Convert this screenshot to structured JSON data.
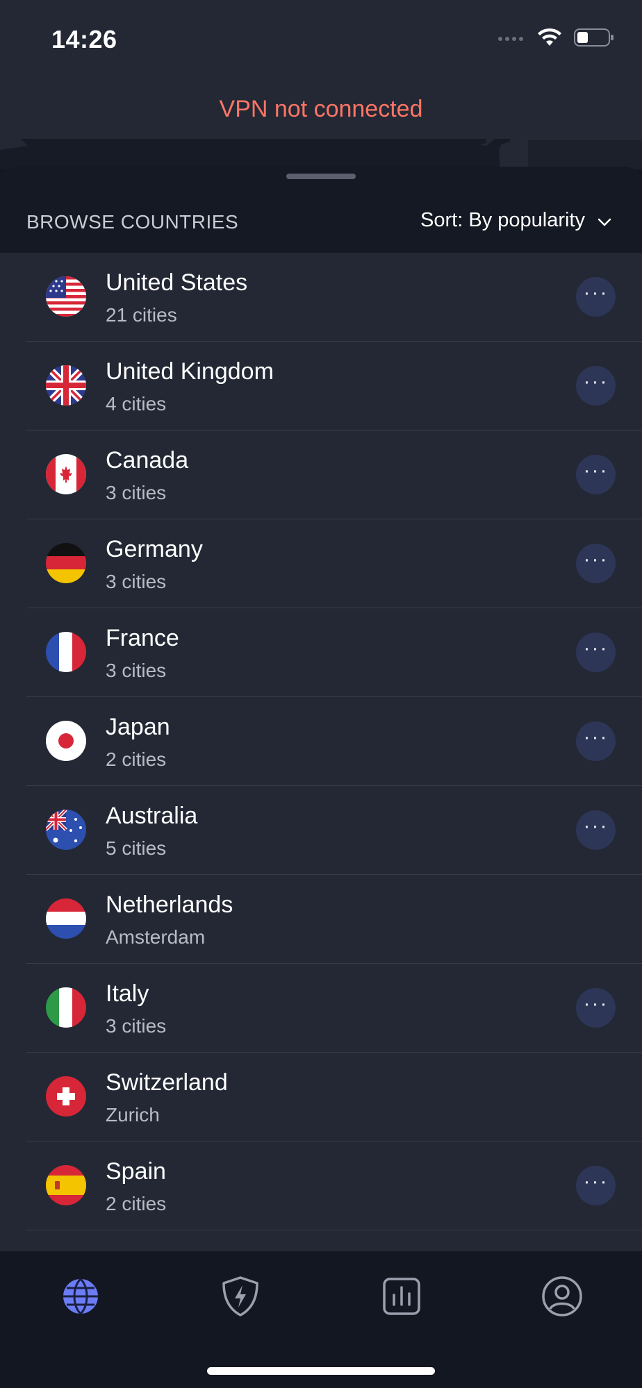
{
  "status_bar": {
    "time": "14:26",
    "battery_level": 0.35
  },
  "vpn_status": {
    "text": "VPN not connected",
    "color": "#ff7566"
  },
  "header": {
    "browse_label": "BROWSE COUNTRIES",
    "sort_label": "Sort: By popularity"
  },
  "countries": [
    {
      "name": "United States",
      "sub": "21 cities",
      "flag": "us-flag-icon",
      "has_more": true
    },
    {
      "name": "United Kingdom",
      "sub": "4 cities",
      "flag": "uk-flag-icon",
      "has_more": true
    },
    {
      "name": "Canada",
      "sub": "3 cities",
      "flag": "canada-flag-icon",
      "has_more": true
    },
    {
      "name": "Germany",
      "sub": "3 cities",
      "flag": "germany-flag-icon",
      "has_more": true
    },
    {
      "name": "France",
      "sub": "3 cities",
      "flag": "france-flag-icon",
      "has_more": true
    },
    {
      "name": "Japan",
      "sub": "2 cities",
      "flag": "japan-flag-icon",
      "has_more": true
    },
    {
      "name": "Australia",
      "sub": "5 cities",
      "flag": "australia-flag-icon",
      "has_more": true
    },
    {
      "name": "Netherlands",
      "sub": "Amsterdam",
      "flag": "netherlands-flag-icon",
      "has_more": false
    },
    {
      "name": "Italy",
      "sub": "3 cities",
      "flag": "italy-flag-icon",
      "has_more": true
    },
    {
      "name": "Switzerland",
      "sub": "Zurich",
      "flag": "switzerland-flag-icon",
      "has_more": false
    },
    {
      "name": "Spain",
      "sub": "2 cities",
      "flag": "spain-flag-icon",
      "has_more": true
    }
  ],
  "tabs": [
    {
      "icon": "globe-icon",
      "active": true
    },
    {
      "icon": "shield-bolt-icon",
      "active": false
    },
    {
      "icon": "stats-icon",
      "active": false
    },
    {
      "icon": "profile-icon",
      "active": false
    }
  ],
  "colors": {
    "accent": "#6b7cf5",
    "background": "#232834",
    "header": "#151923",
    "more_button": "#2e3657"
  }
}
